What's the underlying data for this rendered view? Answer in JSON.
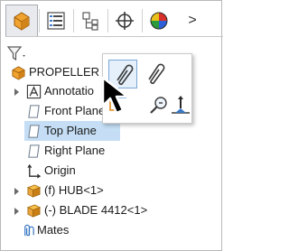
{
  "tabs": [
    {
      "name": "featuremanager",
      "icon": "featuremanager-tree-icon",
      "active": true
    },
    {
      "name": "propertymanager",
      "icon": "propertymanager-icon",
      "active": false
    },
    {
      "name": "configurationmanager",
      "icon": "configurationmanager-icon",
      "active": false
    },
    {
      "name": "dimxpertmanager",
      "icon": "dimxpertmanager-icon",
      "active": false
    },
    {
      "name": "displaymanager",
      "icon": "displaymanager-icon",
      "active": false
    }
  ],
  "tabs_more": ">",
  "filter": {
    "icon": "filter-icon",
    "dropdown": "chevron-down-icon"
  },
  "tree": {
    "items": [
      {
        "label": "PROPELLER A",
        "icon": "assembly-icon",
        "expandable": false,
        "selected": false
      },
      {
        "label": "Annotatio",
        "icon": "annotations-icon",
        "expandable": true,
        "selected": false
      },
      {
        "label": "Front Plane",
        "icon": "plane-icon",
        "expandable": false,
        "selected": false
      },
      {
        "label": "Top Plane",
        "icon": "plane-icon",
        "expandable": false,
        "selected": true
      },
      {
        "label": "Right Plane",
        "icon": "plane-icon",
        "expandable": false,
        "selected": false
      },
      {
        "label": "Origin",
        "icon": "origin-icon",
        "expandable": false,
        "selected": false
      },
      {
        "label": "(f) HUB<1>",
        "icon": "part-icon",
        "expandable": true,
        "selected": false
      },
      {
        "label": "(-) BLADE 4412<1>",
        "icon": "part-icon",
        "expandable": true,
        "selected": false
      },
      {
        "label": "Mates",
        "icon": "mates-icon",
        "expandable": false,
        "selected": false
      }
    ]
  },
  "context_toolbar": {
    "buttons": [
      {
        "name": "mate",
        "icon": "paperclip-icon"
      },
      {
        "name": "smart-mate",
        "icon": "paperclip-icon"
      },
      {
        "name": "normal-to",
        "icon": "normal-to-icon"
      },
      {
        "name": "zoom-to-selection",
        "icon": "zoom-icon"
      },
      {
        "name": "sketch",
        "icon": "sketch-icon"
      }
    ]
  },
  "colors": {
    "selection": "#c5def5",
    "assembly_orange": "#e8a33d",
    "plane_icon": "#6d7d8d"
  }
}
